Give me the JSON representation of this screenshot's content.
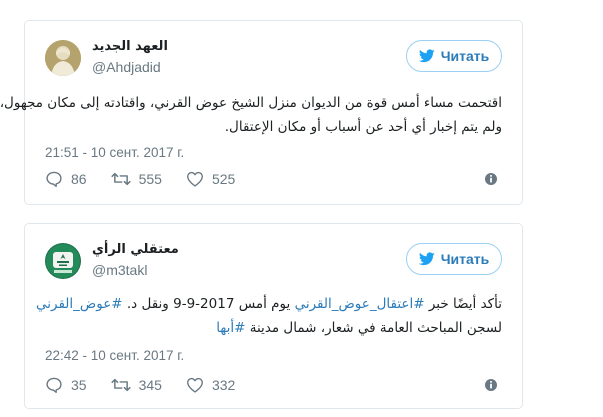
{
  "tweets": [
    {
      "author_name": "العهد الجديد",
      "handle": "@Ahdjadid",
      "follow_label": "Читать",
      "text_lines": [
        "اقتحمت مساء أمس قوة من الديوان منزل الشيخ عوض القرني، واقتادته إلى مكان مجهول،",
        "ولم يتم إخبار أي أحد عن أسباب أو مكان الإعتقال."
      ],
      "timestamp": "21:51 - 10 сент. 2017 г.",
      "replies": "86",
      "retweets": "555",
      "likes": "525"
    },
    {
      "author_name": "معتقلي الرأي",
      "handle": "@m3takl",
      "follow_label": "Читать",
      "line1": {
        "pre": "تأكد أيضًا خبر ",
        "hashtag1": "#اعتقال_عوض_القرني",
        "mid": " يوم أمس 2017-9-9 ونقل د. ",
        "hashtag2": "#عوض_القرني"
      },
      "line2": {
        "pre": "لسجن المباحث العامة في شعار، شمال مدينة ",
        "hashtag": "#أبها"
      },
      "timestamp": "22:42 - 10 сент. 2017 г.",
      "replies": "35",
      "retweets": "345",
      "likes": "332"
    }
  ],
  "colors": {
    "accent": "#2b7bb9",
    "border": "#e1e8ed",
    "muted": "#697882",
    "text": "#1c2022"
  },
  "icons": [
    "twitter-bird-icon",
    "reply-icon",
    "retweet-icon",
    "like-icon",
    "info-icon"
  ]
}
